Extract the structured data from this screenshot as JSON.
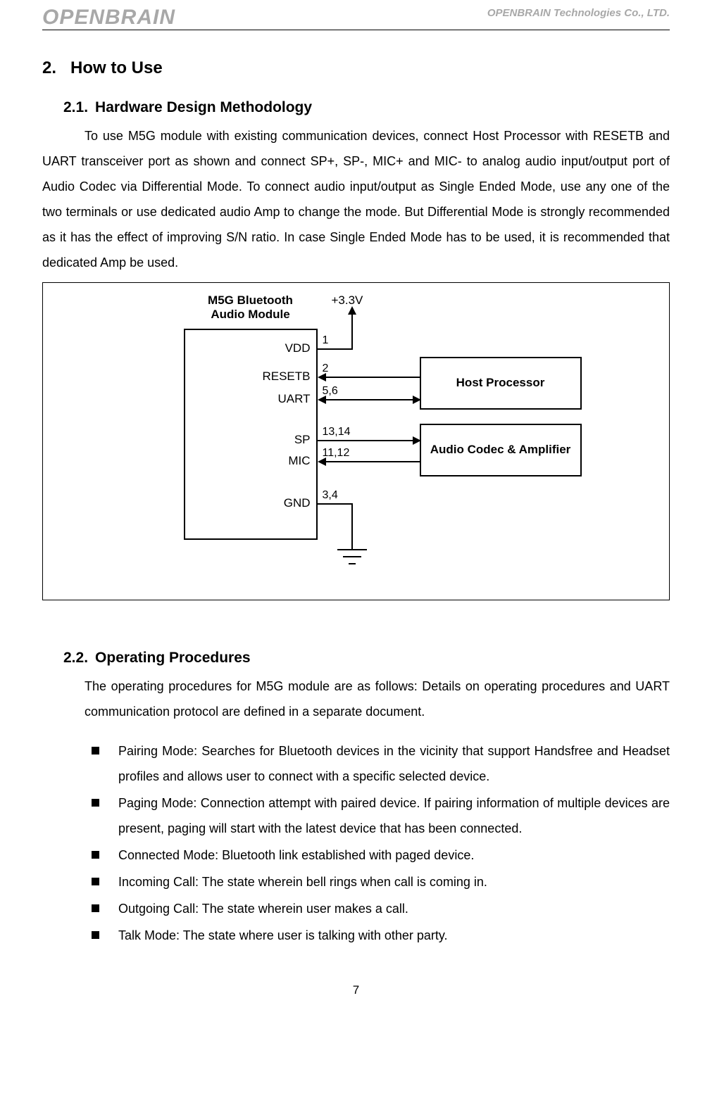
{
  "header": {
    "logo": "OPENBRAIN",
    "company": "OPENBRAIN Technologies Co., LTD."
  },
  "section": {
    "number": "2.",
    "title": "How to Use"
  },
  "sub1": {
    "number": "2.1.",
    "title": "Hardware Design Methodology",
    "paragraph": "To use M5G module with existing communication devices, connect Host Processor with RESETB and UART transceiver port as shown and connect SP+, SP-, MIC+ and MIC- to analog audio input/output port of Audio Codec via Differential Mode. To connect audio input/output as Single Ended Mode, use any one of the two terminals or use dedicated audio Amp to change the mode. But Differential Mode is strongly recommended as it has the effect of improving S/N ratio. In case Single Ended Mode has to be used, it is recommended that dedicated Amp be used."
  },
  "diagram": {
    "title_line1": "M5G Bluetooth",
    "title_line2": "Audio Module",
    "vdd": "VDD",
    "resetb": "RESETB",
    "uart": "UART",
    "sp": "SP",
    "mic": "MIC",
    "gnd": "GND",
    "pin1": "1",
    "pin2": "2",
    "pin56": "5,6",
    "pin1314": "13,14",
    "pin1112": "11,12",
    "pin34": "3,4",
    "v33": "+3.3V",
    "host": "Host Processor",
    "codec": "Audio Codec & Amplifier"
  },
  "sub2": {
    "number": "2.2.",
    "title": "Operating Procedures",
    "intro": "The operating procedures for M5G module are as follows: Details on operating procedures and UART communication protocol are defined in a separate document.",
    "items": [
      "Pairing Mode: Searches for Bluetooth devices in the vicinity that support Handsfree and Headset profiles and allows user to connect with a specific selected device.",
      "Paging Mode: Connection attempt with paired device. If pairing information of multiple devices are present, paging will start with the latest device that has been connected.",
      "Connected Mode: Bluetooth link established with paged device.",
      "Incoming Call: The state wherein bell rings when call is coming in.",
      "Outgoing Call: The state wherein user makes a call.",
      "Talk Mode: The state where user is talking with other party."
    ]
  },
  "page_number": "7"
}
